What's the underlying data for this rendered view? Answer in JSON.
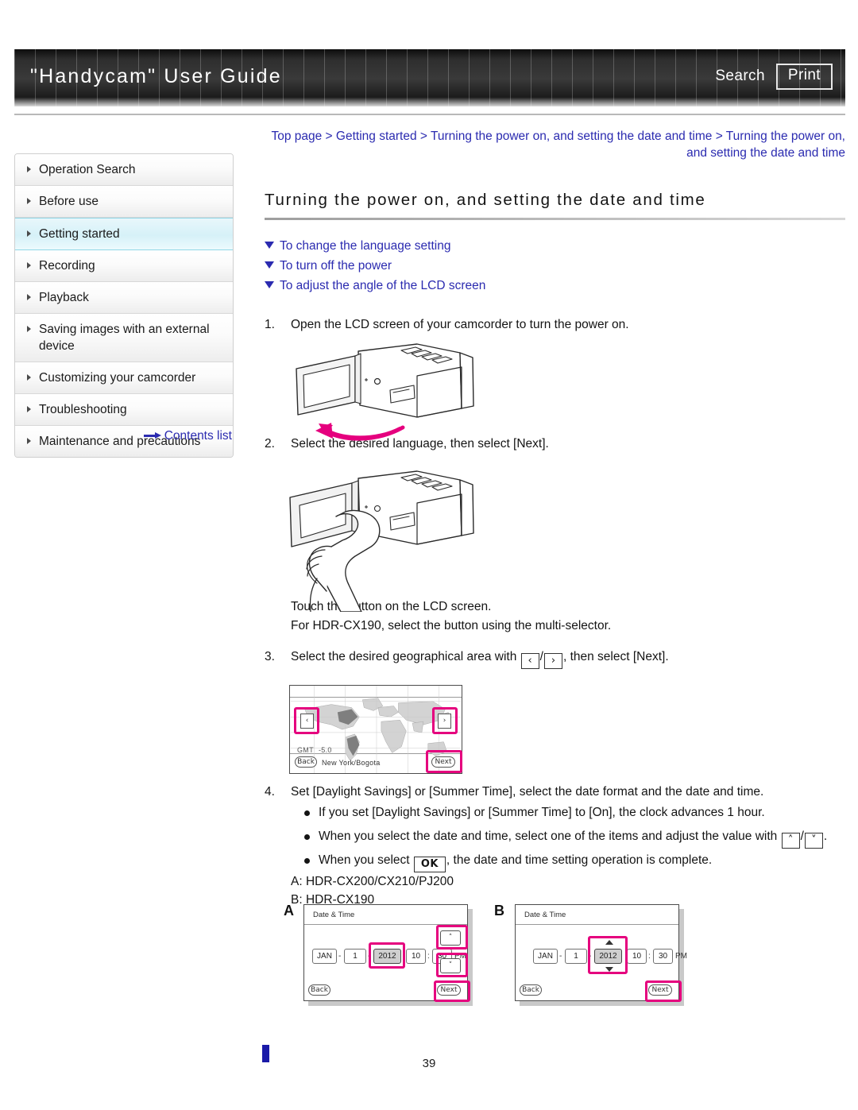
{
  "header": {
    "title": "\"Handycam\" User Guide",
    "search_label": "Search",
    "print_label": "Print"
  },
  "breadcrumb": {
    "text": "Top page > Getting started > Turning the power on, and setting the date and time > Turning the power on, and setting the date and time"
  },
  "sidebar": {
    "items": [
      {
        "label": "Operation Search",
        "active": false
      },
      {
        "label": "Before use",
        "active": false
      },
      {
        "label": "Getting started",
        "active": true
      },
      {
        "label": "Recording",
        "active": false
      },
      {
        "label": "Playback",
        "active": false
      },
      {
        "label": "Saving images with an external device",
        "active": false
      },
      {
        "label": "Customizing your camcorder",
        "active": false
      },
      {
        "label": "Troubleshooting",
        "active": false
      },
      {
        "label": "Maintenance and precautions",
        "active": false
      }
    ],
    "contents_list_label": "Contents list"
  },
  "main": {
    "title": "Turning the power on, and setting the date and time",
    "anchors": [
      "To change the language setting",
      "To turn off the power",
      "To adjust the angle of the LCD screen"
    ],
    "step1": {
      "num": "1.",
      "text": "Open the LCD screen of your camcorder to turn the power on."
    },
    "step2": {
      "num": "2.",
      "text": "Select the desired language, then select [Next].",
      "note1": "Touch the button on the LCD screen.",
      "note2": "For HDR-CX190, select the button using the multi-selector."
    },
    "step3": {
      "num": "3.",
      "text_before": "Select the desired geographical area with",
      "key_left": "‹",
      "key_sep": "/",
      "key_right": "›",
      "text_after": ", then select [Next]."
    },
    "step4": {
      "num": "4.",
      "text": "Set [Daylight Savings] or [Summer Time], select the date format and the date and time.",
      "bullet1": "If you set [Daylight Savings] or [Summer Time] to [On], the clock advances 1 hour.",
      "bullet2_before": "When you select the date and time, select one of the items and adjust the value with",
      "bullet2_key_up": "˄",
      "bullet2_key_sep": "/",
      "bullet2_key_down": "˅",
      "bullet2_after": ".",
      "bullet3_before": "When you select",
      "bullet3_key": "OK",
      "bullet3_after": ", the date and time setting operation is complete.",
      "model_a": "A: HDR-CX200/CX210/PJ200",
      "model_b": "B: HDR-CX190"
    }
  },
  "figures": {
    "area_screen": {
      "gmt": "GMT",
      "offset": "-5.0",
      "back_label": "Back",
      "next_label": "Next",
      "city": "New York/Bogota",
      "prev_glyph": "‹",
      "next_glyph": "›"
    },
    "datetime_a": {
      "label": "A",
      "title": "Date & Time",
      "month": "JAN",
      "day": "1",
      "year": "2012",
      "hour": "10",
      "minute": "30",
      "meridiem": "PM",
      "sep_date": "-",
      "sep_time": ":",
      "up_glyph": "˄",
      "down_glyph": "˅",
      "back_label": "Back",
      "next_label": "Next"
    },
    "datetime_b": {
      "label": "B",
      "title": "Date & Time",
      "month": "JAN",
      "day": "1",
      "year": "2012",
      "hour": "10",
      "minute": "30",
      "meridiem": "PM",
      "sep_date": "-",
      "sep_time": ":",
      "back_label": "Back",
      "next_label": "Next"
    }
  },
  "footer": {
    "page_number": "39"
  },
  "colors": {
    "link": "#2b2bb0",
    "highlight_pink": "#e5007e",
    "active_nav": "#d6f1f8"
  }
}
